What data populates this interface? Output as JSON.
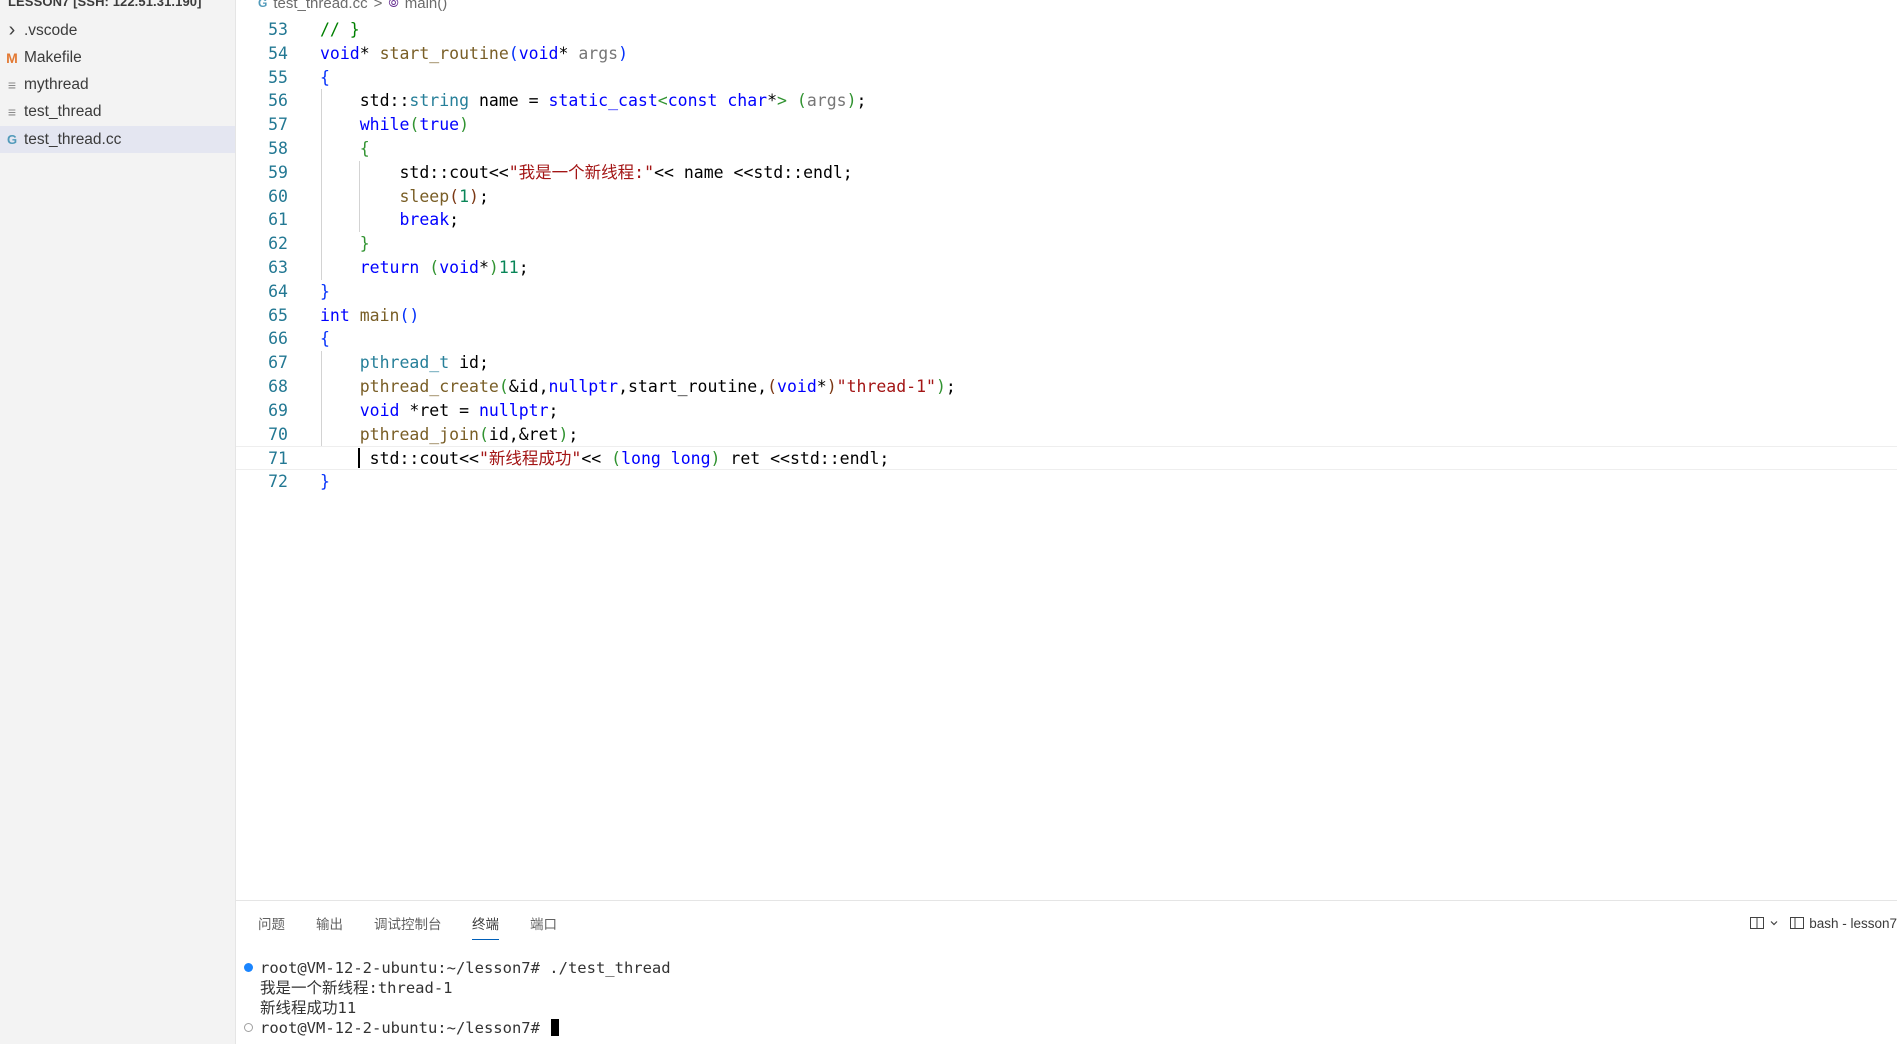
{
  "sidebar": {
    "header": "LESSON7 [SSH: 122.51.31.190]",
    "items": [
      {
        "label": ".vscode",
        "icon": "chevron-right-icon",
        "icon_char": "›"
      },
      {
        "label": "Makefile",
        "icon": "makefile-icon",
        "icon_char": "M"
      },
      {
        "label": "mythread",
        "icon": "file-lines-icon",
        "icon_char": "≡"
      },
      {
        "label": "test_thread",
        "icon": "file-lines-icon",
        "icon_char": "≡"
      },
      {
        "label": "test_thread.cc",
        "icon": "cpp-file-icon",
        "icon_char": "G"
      }
    ],
    "selected_index": 4
  },
  "breadcrumb": {
    "file": "test_thread.cc",
    "separator": ">",
    "symbol": "main()",
    "file_icon_char": "G",
    "symbol_icon_char": "⦾"
  },
  "editor": {
    "current_line_index": 18,
    "lines": [
      {
        "num": "53",
        "html": "<span class=\"c\">// }</span>"
      },
      {
        "num": "54",
        "html": "<span class=\"k\">void</span>* <span class=\"fn\">start_routine</span><span class=\"p1\">(</span><span class=\"k\">void</span>* <span class=\"pg\">args</span><span class=\"p1\">)</span>"
      },
      {
        "num": "55",
        "html": "<span class=\"p1\">{</span>"
      },
      {
        "num": "56",
        "html": "    std::<span class=\"t\">string</span> name = <span class=\"k\">static_cast</span><span class=\"p2\">&lt;</span><span class=\"k\">const</span> <span class=\"k\">char</span>*<span class=\"p2\">&gt;</span> <span class=\"p2\">(</span><span class=\"pg\">args</span><span class=\"p2\">)</span>;"
      },
      {
        "num": "57",
        "html": "    <span class=\"k\">while</span><span class=\"p2\">(</span><span class=\"k\">true</span><span class=\"p2\">)</span>"
      },
      {
        "num": "58",
        "html": "    <span class=\"p2\">{</span>"
      },
      {
        "num": "59",
        "html": "        std::cout&lt;&lt;<span class=\"s\">\"我是一个新线程:\"</span>&lt;&lt; name &lt;&lt;std::endl;"
      },
      {
        "num": "60",
        "html": "        <span class=\"fn\">sleep</span><span class=\"p3\">(</span><span class=\"n\">1</span><span class=\"p3\">)</span>;"
      },
      {
        "num": "61",
        "html": "        <span class=\"k\">break</span>;"
      },
      {
        "num": "62",
        "html": "    <span class=\"p2\">}</span>"
      },
      {
        "num": "63",
        "html": "    <span class=\"k\">return</span> <span class=\"p2\">(</span><span class=\"k\">void</span>*<span class=\"p2\">)</span><span class=\"n\">11</span>;"
      },
      {
        "num": "64",
        "html": "<span class=\"p1\">}</span>"
      },
      {
        "num": "65",
        "html": "<span class=\"k\">int</span> <span class=\"fn\">main</span><span class=\"p1\">()</span>"
      },
      {
        "num": "66",
        "html": "<span class=\"p1\">{</span>"
      },
      {
        "num": "67",
        "html": "    <span class=\"t\">pthread_t</span> id;"
      },
      {
        "num": "68",
        "html": "    <span class=\"fn\">pthread_create</span><span class=\"p2\">(</span>&amp;id,<span class=\"k\">nullptr</span>,start_routine,<span class=\"p3\">(</span><span class=\"k\">void</span>*<span class=\"p3\">)</span><span class=\"s\">\"thread-1\"</span><span class=\"p2\">)</span>;"
      },
      {
        "num": "69",
        "html": "    <span class=\"k\">void</span> *ret = <span class=\"k\">nullptr</span>;"
      },
      {
        "num": "70",
        "html": "    <span class=\"fn\">pthread_join</span><span class=\"p2\">(</span>id,&amp;ret<span class=\"p2\">)</span>;"
      },
      {
        "num": "71",
        "html": "     std::cout&lt;&lt;<span class=\"s\">\"新线程成功\"</span>&lt;&lt; <span class=\"p2\">(</span><span class=\"k\">long</span> <span class=\"k\">long</span><span class=\"p2\">)</span> ret &lt;&lt;std::endl;"
      },
      {
        "num": "72",
        "html": "<span class=\"p1\">}</span>"
      }
    ]
  },
  "panel": {
    "tabs": [
      {
        "label": "问题"
      },
      {
        "label": "输出"
      },
      {
        "label": "调试控制台"
      },
      {
        "label": "终端"
      },
      {
        "label": "端口"
      }
    ],
    "active_tab_index": 3,
    "actions": {
      "split_label": "",
      "terminal_label": "bash - lesson7"
    }
  },
  "terminal": {
    "lines": [
      {
        "text": "root@VM-12-2-ubuntu:~/lesson7# ./test_thread",
        "dot": "ok"
      },
      {
        "text": "我是一个新线程:thread-1",
        "dot": ""
      },
      {
        "text": "新线程成功11",
        "dot": ""
      },
      {
        "text": "root@VM-12-2-ubuntu:~/lesson7# ",
        "dot": "idle",
        "cursor": true
      }
    ]
  },
  "colors": {
    "accent": "#005fb8",
    "sidebar_bg": "#f3f3f3",
    "selected_bg": "#e4e6f1",
    "line_number": "#237893"
  }
}
